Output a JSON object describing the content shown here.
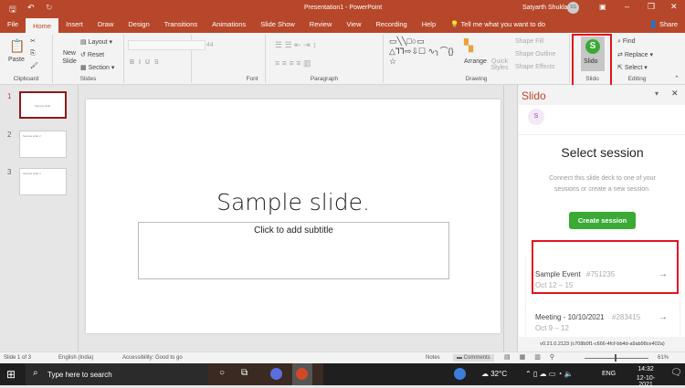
{
  "window": {
    "title": "Presentation1 - PowerPoint",
    "user": "Satyarth Shukla",
    "user_initials": "SS",
    "accent": "#b7472a"
  },
  "tabs": [
    "File",
    "Home",
    "Insert",
    "Draw",
    "Design",
    "Transitions",
    "Animations",
    "Slide Show",
    "Review",
    "View",
    "Recording",
    "Help"
  ],
  "active_tab": "Home",
  "tell_me": "Tell me what you want to do",
  "share": "Share",
  "ribbon": {
    "clipboard": {
      "label": "Clipboard",
      "paste": "Paste"
    },
    "slides": {
      "label": "Slides",
      "new_slide": "New Slide",
      "layout": "Layout",
      "reset": "Reset",
      "section": "Section"
    },
    "font": {
      "label": "Font",
      "size": "44"
    },
    "paragraph": {
      "label": "Paragraph"
    },
    "drawing": {
      "label": "Drawing",
      "arrange": "Arrange",
      "quick_styles": "Quick Styles",
      "shape_fill": "Shape Fill",
      "shape_outline": "Shape Outline",
      "shape_effects": "Shape Effects"
    },
    "slido": {
      "label": "Slido",
      "button": "Slido",
      "icon_letter": "S"
    },
    "editing": {
      "label": "Editing",
      "find": "Find",
      "replace": "Replace",
      "select": "Select"
    }
  },
  "thumbnails": [
    {
      "num": "1",
      "text": "Sample slide."
    },
    {
      "num": "2",
      "text": "Sample slide 2"
    },
    {
      "num": "3",
      "text": "Sample slide 3"
    }
  ],
  "slide": {
    "title": "Sample slide.",
    "subtitle_placeholder": "Click to add subtitle"
  },
  "slido_pane": {
    "title": "Slido",
    "avatar": "S",
    "heading": "Select session",
    "description": "Connect this slide deck to one of your sessions or create a new session.",
    "create_button": "Create session",
    "brand_green": "#3aaa35",
    "sessions": [
      {
        "name": "Sample Event",
        "code": "#751235",
        "dates": "Oct 12 – 15"
      },
      {
        "name": "Meeting - 10/10/2021",
        "code": "#283415",
        "dates": "Oct 9 – 12"
      }
    ],
    "version": "v0.21.0.2123 (c708b0f1-c666-4fcf-bb4d-a9ab98ce402a)"
  },
  "status": {
    "slide": "Slide 1 of 3",
    "language": "English (India)",
    "accessibility": "Accessibility: Good to go",
    "notes": "Notes",
    "comments": "Comments",
    "zoom": "61%"
  },
  "taskbar": {
    "search": "Type here to search",
    "temp": "32°C",
    "lang": "ENG",
    "time": "14:32",
    "date": "12-10-2021"
  }
}
